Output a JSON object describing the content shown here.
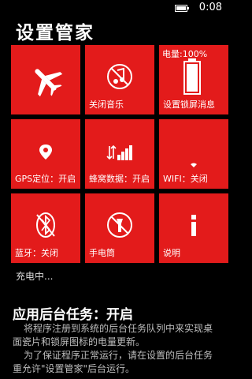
{
  "status": {
    "time": "0:08",
    "battery_icon": "battery-full-icon"
  },
  "app": {
    "title": "设置管家"
  },
  "tiles": [
    {
      "name": "airplane",
      "label": "",
      "icon": "airplane-icon"
    },
    {
      "name": "music",
      "label": "关闭音乐",
      "icon": "music-off-icon"
    },
    {
      "name": "lockscreen",
      "label": "设置锁屏消息",
      "top_label": "电量:100%",
      "icon": "battery-icon"
    },
    {
      "name": "gps",
      "label": "GPS定位：开启",
      "icon": "location-pin-icon"
    },
    {
      "name": "cellular",
      "label": "蜂窝数据：开启",
      "icon": "signal-bars-icon"
    },
    {
      "name": "wifi",
      "label": "WIFI：关闭",
      "icon": "wifi-icon"
    },
    {
      "name": "bluetooth",
      "label": "蓝牙：关闭",
      "icon": "bluetooth-off-icon"
    },
    {
      "name": "flashlight",
      "label": "手电筒",
      "icon": "flashlight-icon"
    },
    {
      "name": "info",
      "label": "说明",
      "icon": "info-icon"
    }
  ],
  "charging_status": "充电中...",
  "background_task": {
    "title": "应用后台任务：开启",
    "desc_line1": "将程序注册到系统的后台任务队列中来实现桌",
    "desc_line2": "面瓷片和锁屏图标的电量更新。",
    "desc_line3": "为了保证程序正常运行，请在设置的后台任务",
    "desc_line4": "重允许\"设置管家\"后台运行。"
  },
  "colors": {
    "tile": "#e31b1b",
    "background": "#000000"
  }
}
